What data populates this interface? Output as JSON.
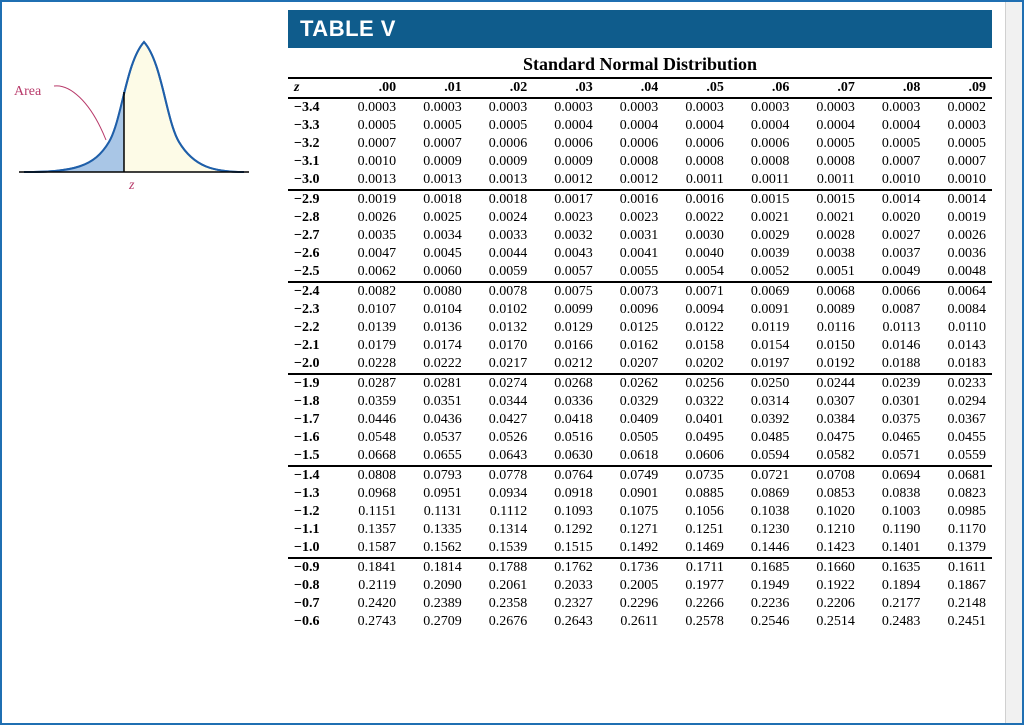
{
  "labels": {
    "area": "Area",
    "z": "z"
  },
  "table": {
    "title": "TABLE V",
    "subtitle": "Standard Normal Distribution",
    "z_header": "z",
    "col_headers": [
      ".00",
      ".01",
      ".02",
      ".03",
      ".04",
      ".05",
      ".06",
      ".07",
      ".08",
      ".09"
    ],
    "groups": [
      {
        "rows": [
          {
            "z": "−3.4",
            "v": [
              "0.0003",
              "0.0003",
              "0.0003",
              "0.0003",
              "0.0003",
              "0.0003",
              "0.0003",
              "0.0003",
              "0.0003",
              "0.0002"
            ]
          },
          {
            "z": "−3.3",
            "v": [
              "0.0005",
              "0.0005",
              "0.0005",
              "0.0004",
              "0.0004",
              "0.0004",
              "0.0004",
              "0.0004",
              "0.0004",
              "0.0003"
            ]
          },
          {
            "z": "−3.2",
            "v": [
              "0.0007",
              "0.0007",
              "0.0006",
              "0.0006",
              "0.0006",
              "0.0006",
              "0.0006",
              "0.0005",
              "0.0005",
              "0.0005"
            ]
          },
          {
            "z": "−3.1",
            "v": [
              "0.0010",
              "0.0009",
              "0.0009",
              "0.0009",
              "0.0008",
              "0.0008",
              "0.0008",
              "0.0008",
              "0.0007",
              "0.0007"
            ]
          },
          {
            "z": "−3.0",
            "v": [
              "0.0013",
              "0.0013",
              "0.0013",
              "0.0012",
              "0.0012",
              "0.0011",
              "0.0011",
              "0.0011",
              "0.0010",
              "0.0010"
            ]
          }
        ]
      },
      {
        "rows": [
          {
            "z": "−2.9",
            "v": [
              "0.0019",
              "0.0018",
              "0.0018",
              "0.0017",
              "0.0016",
              "0.0016",
              "0.0015",
              "0.0015",
              "0.0014",
              "0.0014"
            ]
          },
          {
            "z": "−2.8",
            "v": [
              "0.0026",
              "0.0025",
              "0.0024",
              "0.0023",
              "0.0023",
              "0.0022",
              "0.0021",
              "0.0021",
              "0.0020",
              "0.0019"
            ]
          },
          {
            "z": "−2.7",
            "v": [
              "0.0035",
              "0.0034",
              "0.0033",
              "0.0032",
              "0.0031",
              "0.0030",
              "0.0029",
              "0.0028",
              "0.0027",
              "0.0026"
            ]
          },
          {
            "z": "−2.6",
            "v": [
              "0.0047",
              "0.0045",
              "0.0044",
              "0.0043",
              "0.0041",
              "0.0040",
              "0.0039",
              "0.0038",
              "0.0037",
              "0.0036"
            ]
          },
          {
            "z": "−2.5",
            "v": [
              "0.0062",
              "0.0060",
              "0.0059",
              "0.0057",
              "0.0055",
              "0.0054",
              "0.0052",
              "0.0051",
              "0.0049",
              "0.0048"
            ]
          }
        ]
      },
      {
        "rows": [
          {
            "z": "−2.4",
            "v": [
              "0.0082",
              "0.0080",
              "0.0078",
              "0.0075",
              "0.0073",
              "0.0071",
              "0.0069",
              "0.0068",
              "0.0066",
              "0.0064"
            ]
          },
          {
            "z": "−2.3",
            "v": [
              "0.0107",
              "0.0104",
              "0.0102",
              "0.0099",
              "0.0096",
              "0.0094",
              "0.0091",
              "0.0089",
              "0.0087",
              "0.0084"
            ]
          },
          {
            "z": "−2.2",
            "v": [
              "0.0139",
              "0.0136",
              "0.0132",
              "0.0129",
              "0.0125",
              "0.0122",
              "0.0119",
              "0.0116",
              "0.0113",
              "0.0110"
            ]
          },
          {
            "z": "−2.1",
            "v": [
              "0.0179",
              "0.0174",
              "0.0170",
              "0.0166",
              "0.0162",
              "0.0158",
              "0.0154",
              "0.0150",
              "0.0146",
              "0.0143"
            ]
          },
          {
            "z": "−2.0",
            "v": [
              "0.0228",
              "0.0222",
              "0.0217",
              "0.0212",
              "0.0207",
              "0.0202",
              "0.0197",
              "0.0192",
              "0.0188",
              "0.0183"
            ]
          }
        ]
      },
      {
        "rows": [
          {
            "z": "−1.9",
            "v": [
              "0.0287",
              "0.0281",
              "0.0274",
              "0.0268",
              "0.0262",
              "0.0256",
              "0.0250",
              "0.0244",
              "0.0239",
              "0.0233"
            ]
          },
          {
            "z": "−1.8",
            "v": [
              "0.0359",
              "0.0351",
              "0.0344",
              "0.0336",
              "0.0329",
              "0.0322",
              "0.0314",
              "0.0307",
              "0.0301",
              "0.0294"
            ]
          },
          {
            "z": "−1.7",
            "v": [
              "0.0446",
              "0.0436",
              "0.0427",
              "0.0418",
              "0.0409",
              "0.0401",
              "0.0392",
              "0.0384",
              "0.0375",
              "0.0367"
            ]
          },
          {
            "z": "−1.6",
            "v": [
              "0.0548",
              "0.0537",
              "0.0526",
              "0.0516",
              "0.0505",
              "0.0495",
              "0.0485",
              "0.0475",
              "0.0465",
              "0.0455"
            ]
          },
          {
            "z": "−1.5",
            "v": [
              "0.0668",
              "0.0655",
              "0.0643",
              "0.0630",
              "0.0618",
              "0.0606",
              "0.0594",
              "0.0582",
              "0.0571",
              "0.0559"
            ]
          }
        ]
      },
      {
        "rows": [
          {
            "z": "−1.4",
            "v": [
              "0.0808",
              "0.0793",
              "0.0778",
              "0.0764",
              "0.0749",
              "0.0735",
              "0.0721",
              "0.0708",
              "0.0694",
              "0.0681"
            ]
          },
          {
            "z": "−1.3",
            "v": [
              "0.0968",
              "0.0951",
              "0.0934",
              "0.0918",
              "0.0901",
              "0.0885",
              "0.0869",
              "0.0853",
              "0.0838",
              "0.0823"
            ]
          },
          {
            "z": "−1.2",
            "v": [
              "0.1151",
              "0.1131",
              "0.1112",
              "0.1093",
              "0.1075",
              "0.1056",
              "0.1038",
              "0.1020",
              "0.1003",
              "0.0985"
            ]
          },
          {
            "z": "−1.1",
            "v": [
              "0.1357",
              "0.1335",
              "0.1314",
              "0.1292",
              "0.1271",
              "0.1251",
              "0.1230",
              "0.1210",
              "0.1190",
              "0.1170"
            ]
          },
          {
            "z": "−1.0",
            "v": [
              "0.1587",
              "0.1562",
              "0.1539",
              "0.1515",
              "0.1492",
              "0.1469",
              "0.1446",
              "0.1423",
              "0.1401",
              "0.1379"
            ]
          }
        ]
      },
      {
        "rows": [
          {
            "z": "−0.9",
            "v": [
              "0.1841",
              "0.1814",
              "0.1788",
              "0.1762",
              "0.1736",
              "0.1711",
              "0.1685",
              "0.1660",
              "0.1635",
              "0.1611"
            ]
          },
          {
            "z": "−0.8",
            "v": [
              "0.2119",
              "0.2090",
              "0.2061",
              "0.2033",
              "0.2005",
              "0.1977",
              "0.1949",
              "0.1922",
              "0.1894",
              "0.1867"
            ]
          },
          {
            "z": "−0.7",
            "v": [
              "0.2420",
              "0.2389",
              "0.2358",
              "0.2327",
              "0.2296",
              "0.2266",
              "0.2236",
              "0.2206",
              "0.2177",
              "0.2148"
            ]
          },
          {
            "z": "−0.6",
            "v": [
              "0.2743",
              "0.2709",
              "0.2676",
              "0.2643",
              "0.2611",
              "0.2578",
              "0.2546",
              "0.2514",
              "0.2483",
              "0.2451"
            ]
          }
        ]
      }
    ]
  }
}
